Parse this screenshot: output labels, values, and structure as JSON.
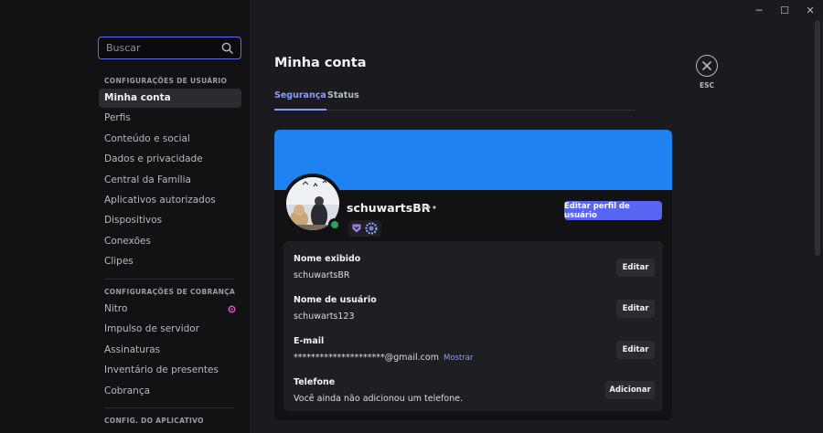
{
  "window": {
    "minimize": "─",
    "maximize": "☐",
    "close": "✕"
  },
  "search": {
    "placeholder": "Buscar"
  },
  "sidebar": {
    "user_settings_header": "CONFIGURAÇÕES DE USUÁRIO",
    "user_items": [
      {
        "label": "Minha conta",
        "active": true
      },
      {
        "label": "Perfis"
      },
      {
        "label": "Conteúdo e social"
      },
      {
        "label": "Dados e privacidade"
      },
      {
        "label": "Central da Família"
      },
      {
        "label": "Aplicativos autorizados"
      },
      {
        "label": "Dispositivos"
      },
      {
        "label": "Conexões"
      },
      {
        "label": "Clipes"
      }
    ],
    "billing_header": "CONFIGURAÇÕES DE COBRANÇA",
    "billing_items": [
      {
        "label": "Nitro"
      },
      {
        "label": "Impulso de servidor"
      },
      {
        "label": "Assinaturas"
      },
      {
        "label": "Inventário de presentes"
      },
      {
        "label": "Cobrança"
      }
    ],
    "app_settings_header": "CONFIG. DO APLICATIVO"
  },
  "main": {
    "title": "Minha conta",
    "tabs": [
      {
        "label": "Segurança",
        "active": true
      },
      {
        "label": "Status"
      }
    ],
    "esc_label": "ESC"
  },
  "profile": {
    "username": "schuwartsBR",
    "edit_profile_label": "Editar perfil de usuário",
    "banner_color": "#1e82f0",
    "status": "online",
    "status_color": "#23a55a"
  },
  "fields": {
    "display_name": {
      "label": "Nome exibido",
      "value": "schuwartsBR",
      "action": "Editar"
    },
    "username": {
      "label": "Nome de usuário",
      "value": "schuwarts123",
      "action": "Editar"
    },
    "email": {
      "label": "E-mail",
      "value": "*********************@gmail.com",
      "reveal": "Mostrar",
      "action": "Editar"
    },
    "phone": {
      "label": "Telefone",
      "value": "Você ainda não adicionou um telefone.",
      "action": "Adicionar"
    }
  },
  "colors": {
    "accent": "#5865f2",
    "link": "#8c9cf5",
    "nitro": "#e455c6"
  }
}
